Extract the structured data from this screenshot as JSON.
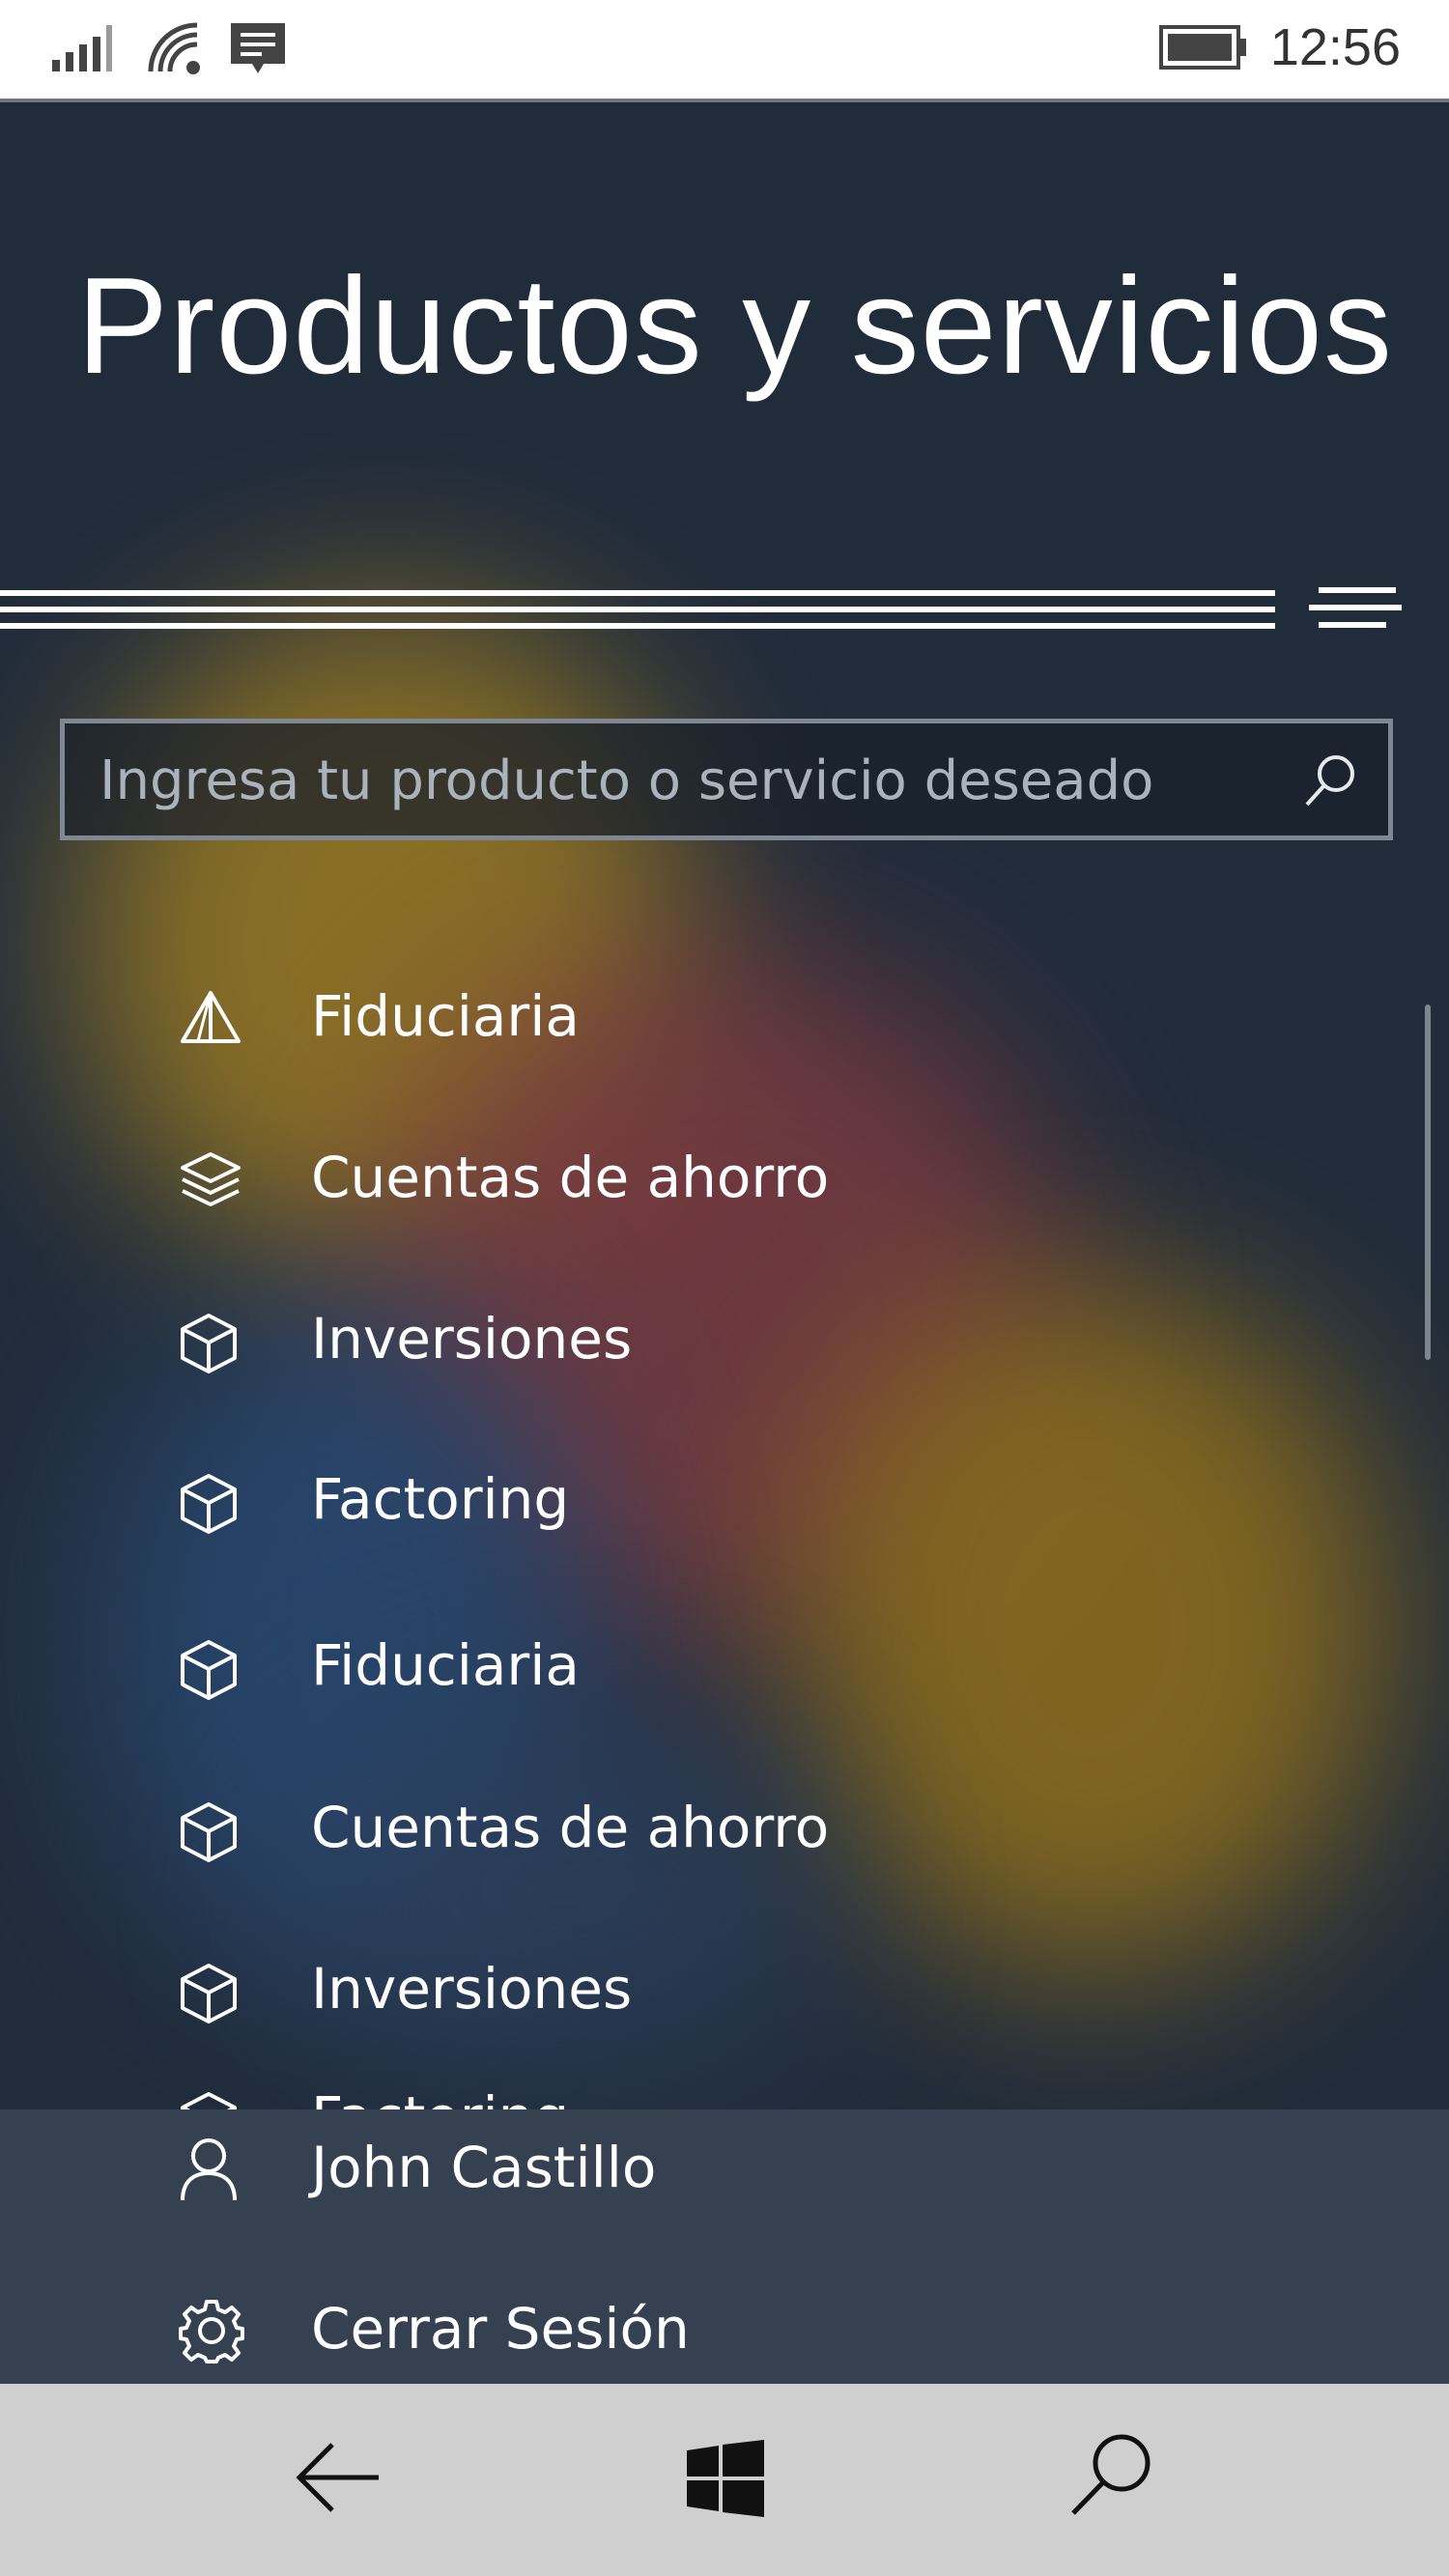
{
  "status_bar": {
    "time": "12:56",
    "icons": [
      "signal-icon",
      "wifi-icon",
      "message-icon",
      "battery-icon"
    ]
  },
  "header": {
    "title": "Productos y servicios",
    "menu_icon": "hamburger-menu-icon"
  },
  "search": {
    "placeholder": "Ingresa tu producto o servicio deseado",
    "value": "",
    "icon": "search-icon"
  },
  "products": [
    {
      "label": "Fiduciaria",
      "icon": "pyramid-icon"
    },
    {
      "label": "Cuentas de ahorro",
      "icon": "layers-icon"
    },
    {
      "label": "Inversiones",
      "icon": "cube-icon"
    },
    {
      "label": "Factoring",
      "icon": "cube-icon"
    },
    {
      "label": "Fiduciaria",
      "icon": "cube-icon"
    },
    {
      "label": "Cuentas de ahorro",
      "icon": "cube-icon"
    },
    {
      "label": "Inversiones",
      "icon": "cube-icon"
    },
    {
      "label": "Factoring",
      "icon": "cube-icon"
    }
  ],
  "footer": {
    "user": {
      "label": "John Castillo",
      "icon": "user-icon"
    },
    "logout": {
      "label": "Cerrar Sesión",
      "icon": "gear-icon"
    }
  },
  "nav_bar": {
    "icons": [
      "back-arrow-icon",
      "windows-icon",
      "search-icon"
    ]
  },
  "colors": {
    "background": "#212c3b",
    "footer": "#354150",
    "nav_bar": "#cfcfcf",
    "text": "#ffffff",
    "blob_gold": "#9a7a23",
    "blob_red": "#7a3a40",
    "blob_blue": "#28476e"
  }
}
